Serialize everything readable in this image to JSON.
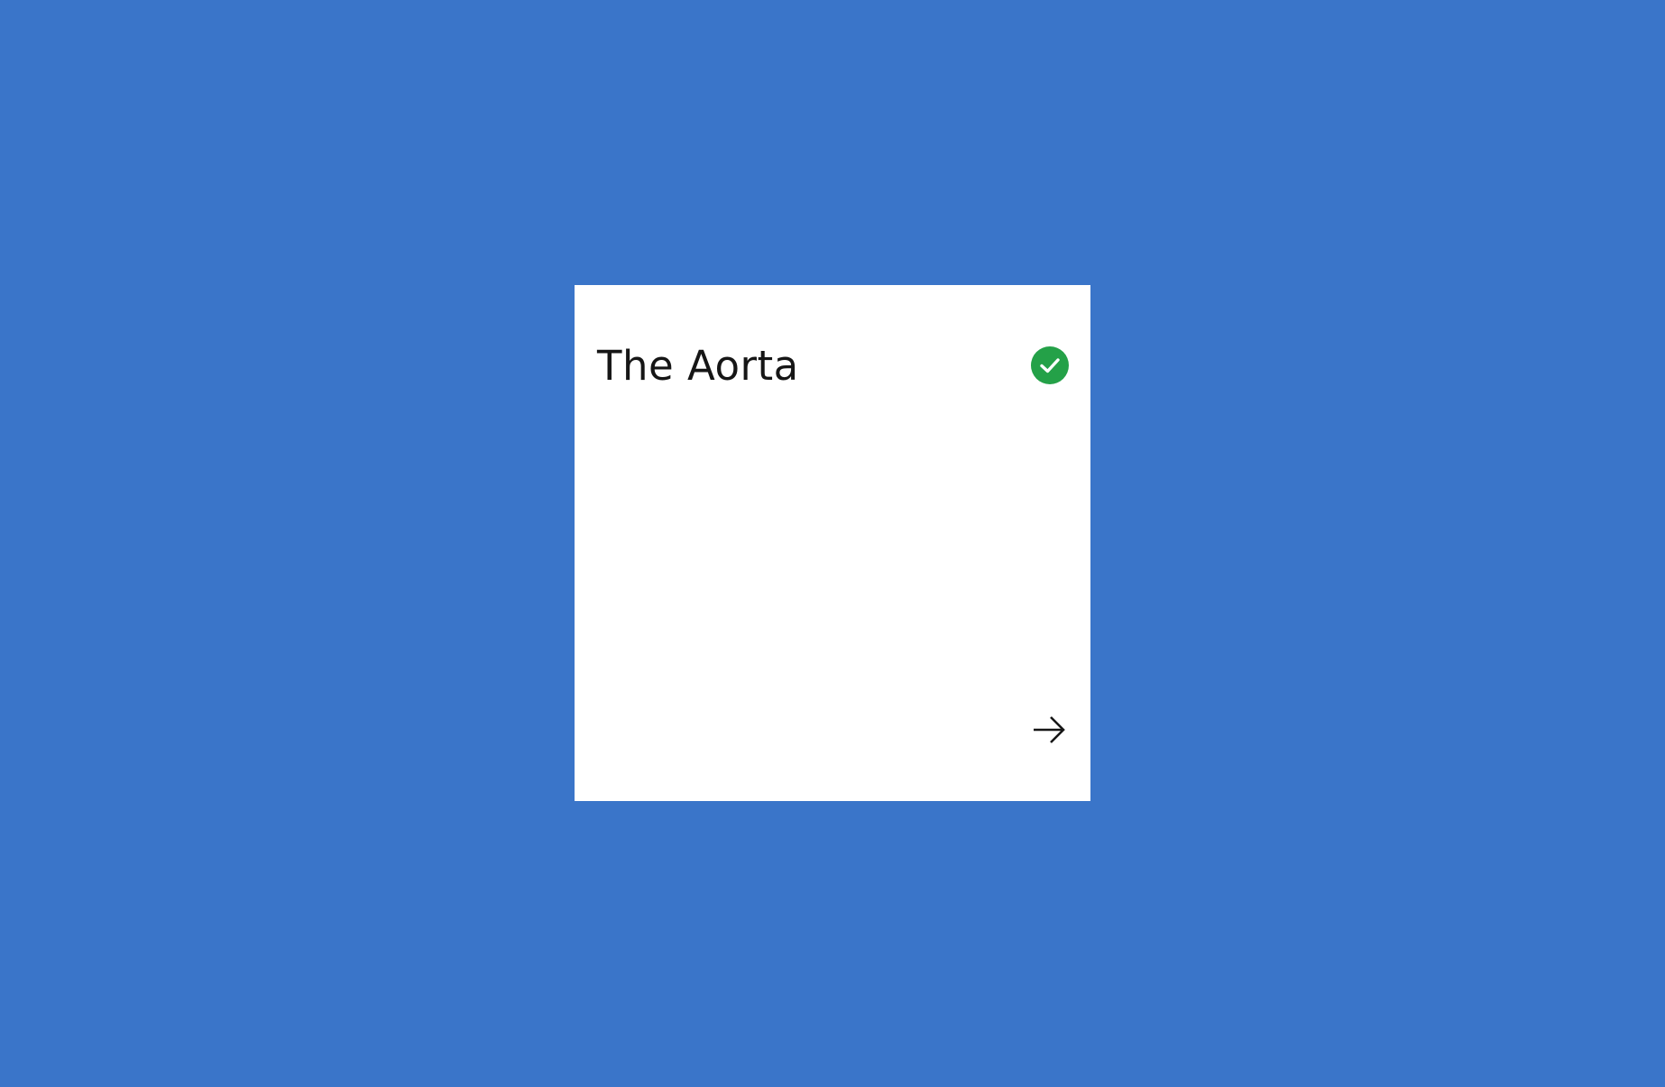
{
  "tile": {
    "title": "The Aorta",
    "status_icon": "checkmark-filled-icon",
    "status_color": "#24a148",
    "action_icon": "arrow-right-icon"
  },
  "colors": {
    "background": "#3a75c9",
    "tile": "#ffffff",
    "text": "#161616"
  }
}
